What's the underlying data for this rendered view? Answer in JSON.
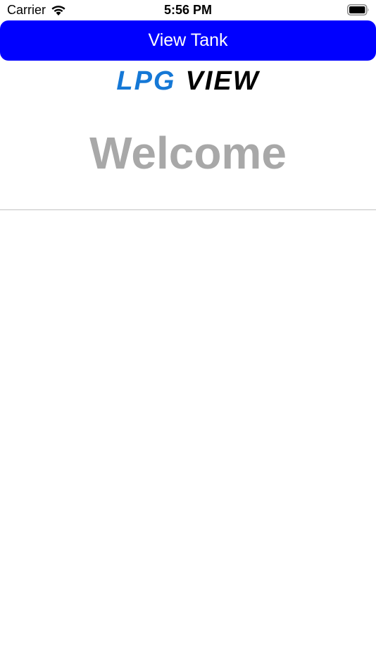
{
  "status_bar": {
    "carrier": "Carrier",
    "time": "5:56 PM",
    "wifi_icon": "wifi-icon",
    "battery_icon": "battery-icon"
  },
  "header": {
    "button_label": "View Tank",
    "button_color": "#0000ff"
  },
  "logo": {
    "part1": "LPG",
    "part2": "VIEW",
    "part1_color": "#1578d6",
    "part2_color": "#000000"
  },
  "main": {
    "welcome_text": "Welcome"
  }
}
